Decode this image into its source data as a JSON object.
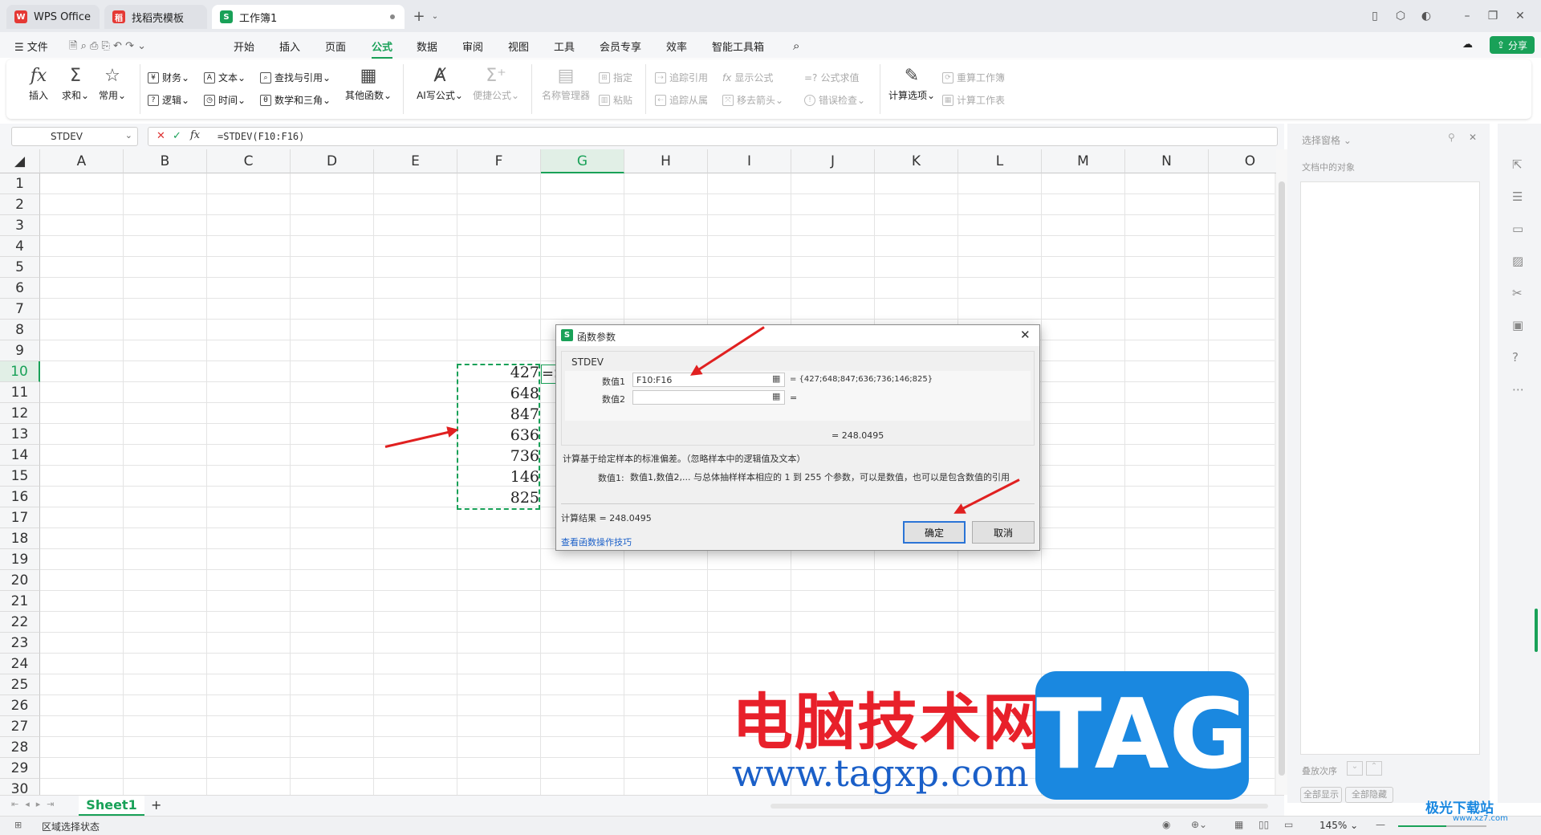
{
  "titlebar": {
    "tabs": [
      {
        "label": "WPS Office"
      },
      {
        "label": "找稻壳模板"
      },
      {
        "label": "工作簿1"
      }
    ],
    "new_tab": "+"
  },
  "menubar": {
    "file": "文件",
    "items": [
      "开始",
      "插入",
      "页面",
      "公式",
      "数据",
      "审阅",
      "视图",
      "工具",
      "会员专享",
      "效率",
      "智能工具箱"
    ],
    "active": "公式",
    "share": "分享"
  },
  "ribbon": {
    "insert": "插入",
    "sum": "求和",
    "common": "常用",
    "finance": "财务",
    "text": "文本",
    "lookup": "查找与引用",
    "logic": "逻辑",
    "time": "时间",
    "math": "数学和三角",
    "other": "其他函数",
    "ai": "AI写公式",
    "quick": "便捷公式",
    "name_mgr": "名称管理器",
    "specify": "指定",
    "paste": "粘贴",
    "trace_prec": "追踪引用",
    "trace_dep": "追踪从属",
    "show_formula": "显示公式",
    "remove_arrows": "移去箭头",
    "eval_formula": "公式求值",
    "error_check": "错误检查",
    "calc_options": "计算选项",
    "recalc_book": "重算工作簿",
    "calc_sheet": "计算工作表"
  },
  "formula_bar": {
    "name_box": "STDEV",
    "formula": "=STDEV(F10:F16)"
  },
  "grid": {
    "columns": [
      "A",
      "B",
      "C",
      "D",
      "E",
      "F",
      "G",
      "H",
      "I",
      "J",
      "K",
      "L",
      "M",
      "N",
      "O"
    ],
    "rows": [
      "1",
      "2",
      "3",
      "4",
      "5",
      "6",
      "7",
      "8",
      "9",
      "10",
      "11",
      "12",
      "13",
      "14",
      "15",
      "16",
      "17",
      "18",
      "19",
      "20",
      "21",
      "22",
      "23",
      "24",
      "25",
      "26",
      "27",
      "28",
      "29",
      "30"
    ],
    "values": [
      "427",
      "648",
      "847",
      "636",
      "736",
      "146",
      "825"
    ],
    "g10": "=S"
  },
  "dialog": {
    "title": "函数参数",
    "func": "STDEV",
    "arg1_label": "数值1",
    "arg1_value": "F10:F16",
    "arg1_result": "= {427;648;847;636;736;146;825}",
    "arg2_label": "数值2",
    "arg2_result": "=",
    "result_line": "= 248.0495",
    "description": "计算基于给定样本的标准偏差。（忽略样本中的逻辑值及文本）",
    "arg_desc_label": "数值1:",
    "arg_desc": "数值1,数值2,... 与总体抽样样本相应的 1 到 255 个参数，可以是数值，也可以是包含数值的引用",
    "calc_result": "计算结果 = 248.0495",
    "help_link": "查看函数操作技巧",
    "ok": "确定",
    "cancel": "取消"
  },
  "right_pane": {
    "title": "选择窗格",
    "subtitle": "文档中的对象",
    "order_label": "叠放次序",
    "show_all": "全部显示",
    "hide_all": "全部隐藏"
  },
  "sheet_tabs": {
    "active": "Sheet1",
    "add": "+"
  },
  "status": {
    "left": "区域选择状态",
    "zoom": "145%"
  },
  "watermark": {
    "cn": "电脑技术网",
    "url": "www.tagxp.com",
    "logo": "TAG",
    "corner": "极光下载站",
    "corner_url": "www.xz7.com"
  },
  "colors": {
    "accent": "#19a158",
    "arrow": "#e02020",
    "watermark_red": "#e8202a",
    "watermark_blue": "#1a88e0"
  }
}
